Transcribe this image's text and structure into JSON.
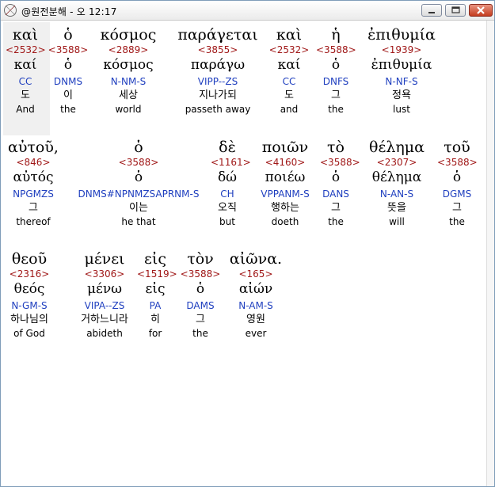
{
  "window": {
    "title": "@원전분해 - 오 12:17",
    "colors": {
      "greek": "#000000",
      "strong": "#a01818",
      "morph": "#1f3fbf",
      "accent_close": "#c43c1e"
    },
    "icons": {
      "app": "compass-icon",
      "minimize": "minimize-icon",
      "maximize": "maximize-icon",
      "close": "close-icon"
    }
  },
  "rows": [
    {
      "words": [
        {
          "greek": "καὶ",
          "strong": "<2532>",
          "lemma": "καί",
          "morph": "CC",
          "korean": "도",
          "english": "And"
        },
        {
          "greek": "ὁ",
          "strong": "<3588>",
          "lemma": "ὁ",
          "morph": "DNMS",
          "korean": "이",
          "english": "the"
        },
        {
          "greek": "κόσμος",
          "strong": "<2889>",
          "lemma": "κόσμος",
          "morph": "N-NM-S",
          "korean": "세상",
          "english": "world"
        },
        {
          "greek": "παράγεται",
          "strong": "<3855>",
          "lemma": "παράγω",
          "morph": "VIPP--ZS",
          "korean": "지나가되",
          "english": "passeth away"
        },
        {
          "greek": "καὶ",
          "strong": "<2532>",
          "lemma": "καί",
          "morph": "CC",
          "korean": "도",
          "english": "and"
        },
        {
          "greek": "ἡ",
          "strong": "<3588>",
          "lemma": "ὁ",
          "morph": "DNFS",
          "korean": "그",
          "english": "the"
        },
        {
          "greek": "ἐπιθυμία",
          "strong": "<1939>",
          "lemma": "ἐπιθυμία",
          "morph": "N-NF-S",
          "korean": "정욕",
          "english": "lust"
        }
      ]
    },
    {
      "words": [
        {
          "greek": "αὐτοῦ,",
          "strong": "<846>",
          "lemma": "αὐτός",
          "morph": "NPGMZS",
          "korean": "그",
          "english": "thereof"
        },
        {
          "greek": "ὁ",
          "strong": "<3588>",
          "lemma": "ὁ",
          "morph": "DNMS#NPNMZSAPRNM-S",
          "korean": "이는",
          "english": "he that"
        },
        {
          "greek": "δὲ",
          "strong": "<1161>",
          "lemma": "δώ",
          "morph": "CH",
          "korean": "오직",
          "english": "but"
        },
        {
          "greek": "ποιῶν",
          "strong": "<4160>",
          "lemma": "ποιέω",
          "morph": "VPPANM-S",
          "korean": "행하는",
          "english": "doeth"
        },
        {
          "greek": "τὸ",
          "strong": "<3588>",
          "lemma": "ὁ",
          "morph": "DANS",
          "korean": "그",
          "english": "the"
        },
        {
          "greek": "θέλημα",
          "strong": "<2307>",
          "lemma": "θέλημα",
          "morph": "N-AN-S",
          "korean": "뜻을",
          "english": "will"
        },
        {
          "greek": "τοῦ",
          "strong": "<3588>",
          "lemma": "ὁ",
          "morph": "DGMS",
          "korean": "그",
          "english": "the"
        }
      ]
    },
    {
      "words": [
        {
          "greek": "θεοῦ",
          "strong": "<2316>",
          "lemma": "θεός",
          "morph": "N-GM-S",
          "korean": "하나님의",
          "english": "of God"
        },
        {
          "greek": "μένει",
          "strong": "<3306>",
          "lemma": "μένω",
          "morph": "VIPA--ZS",
          "korean": "거하느니라",
          "english": "abideth"
        },
        {
          "greek": "εἰς",
          "strong": "<1519>",
          "lemma": "εἰς",
          "morph": "PA",
          "korean": "히",
          "english": "for"
        },
        {
          "greek": "τὸν",
          "strong": "<3588>",
          "lemma": "ὁ",
          "morph": "DAMS",
          "korean": "그",
          "english": "the"
        },
        {
          "greek": "αἰῶνα.",
          "strong": "<165>",
          "lemma": "αἰών",
          "morph": "N-AM-S",
          "korean": "영원",
          "english": "ever"
        }
      ]
    }
  ]
}
